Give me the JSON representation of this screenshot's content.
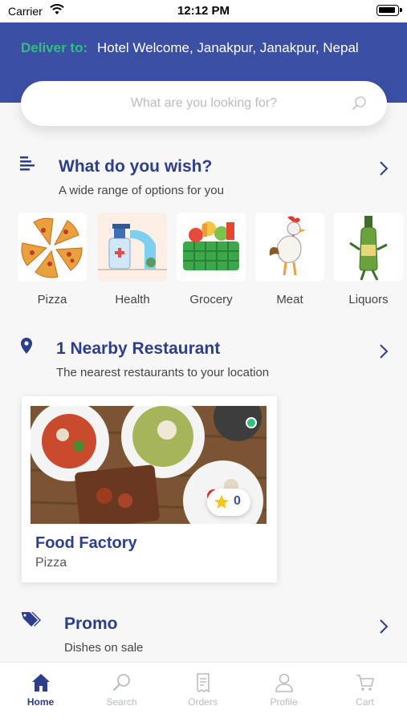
{
  "status_bar": {
    "carrier": "Carrier",
    "time": "12:12 PM"
  },
  "header": {
    "deliver_label": "Deliver to:",
    "address": "Hotel Welcome, Janakpur, Janakpur, Nepal"
  },
  "search": {
    "placeholder": "What are you looking for?"
  },
  "wish_section": {
    "title": "What do you wish?",
    "subtitle": "A wide range of options for you",
    "categories": [
      {
        "label": "Pizza",
        "icon": "pizza-icon"
      },
      {
        "label": "Health",
        "icon": "hand-sanitizer-icon"
      },
      {
        "label": "Grocery",
        "icon": "grocery-basket-icon"
      },
      {
        "label": "Meat",
        "icon": "chicken-icon"
      },
      {
        "label": "Liquors",
        "icon": "bottle-icon"
      }
    ]
  },
  "nearby_section": {
    "title": "1 Nearby Restaurant",
    "subtitle": "The nearest restaurants to your location",
    "restaurants": [
      {
        "name": "Food Factory",
        "cuisine": "Pizza",
        "rating": "0",
        "status_color": "#2ec27e"
      }
    ]
  },
  "promo_section": {
    "title": "Promo",
    "subtitle": "Dishes on sale"
  },
  "bottom_nav": {
    "items": [
      {
        "label": "Home",
        "icon": "home-icon",
        "active": true
      },
      {
        "label": "Search",
        "icon": "search-icon",
        "active": false
      },
      {
        "label": "Orders",
        "icon": "receipt-icon",
        "active": false
      },
      {
        "label": "Profile",
        "icon": "user-icon",
        "active": false
      },
      {
        "label": "Cart",
        "icon": "cart-icon",
        "active": false
      }
    ]
  },
  "colors": {
    "primary": "#3b4fa5",
    "accent_green": "#2ec27e",
    "title_blue": "#2c3e8c"
  }
}
